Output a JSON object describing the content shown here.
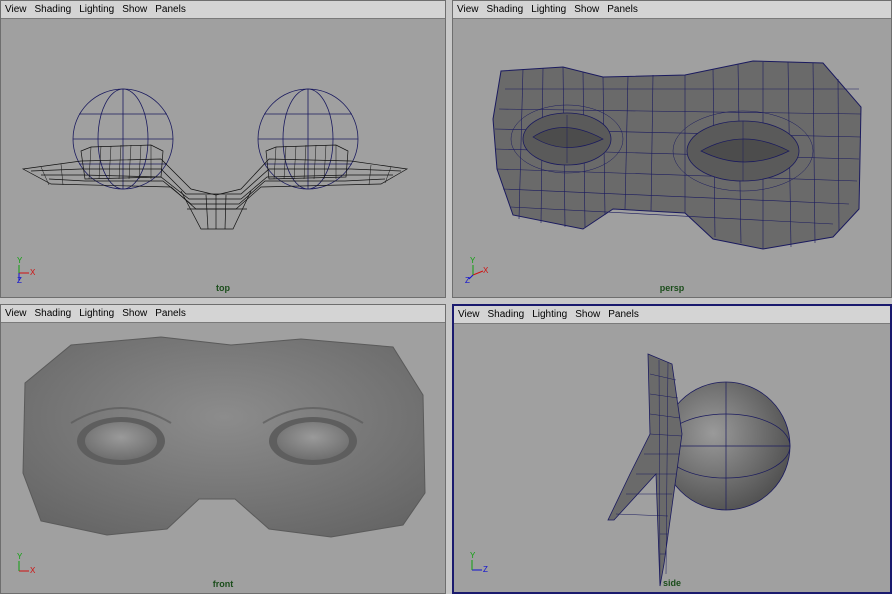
{
  "panels": [
    {
      "id": "top",
      "menu": [
        "View",
        "Shading",
        "Lighting",
        "Show",
        "Panels"
      ],
      "camera": "top",
      "axes": {
        "primary": "X",
        "up": "Y",
        "depth": "Z"
      },
      "active": false
    },
    {
      "id": "persp",
      "menu": [
        "View",
        "Shading",
        "Lighting",
        "Show",
        "Panels"
      ],
      "camera": "persp",
      "axes": {
        "primary": "X",
        "up": "Y",
        "depth": "Z"
      },
      "active": false
    },
    {
      "id": "front",
      "menu": [
        "View",
        "Shading",
        "Lighting",
        "Show",
        "Panels"
      ],
      "camera": "front",
      "axes": {
        "primary": "X",
        "up": "Y",
        "depth": ""
      },
      "active": false
    },
    {
      "id": "side",
      "menu": [
        "View",
        "Shading",
        "Lighting",
        "Show",
        "Panels"
      ],
      "camera": "side",
      "axes": {
        "primary": "Z",
        "up": "Y",
        "depth": ""
      },
      "active": true
    }
  ],
  "colors": {
    "viewport_bg": "#a0a0a0",
    "wire": "#1a1a5e",
    "mesh_fill": "#6a6a6a",
    "label": "#1b4d1b",
    "axis_x": "#d01010",
    "axis_y": "#10a010",
    "axis_z": "#1010d0"
  }
}
